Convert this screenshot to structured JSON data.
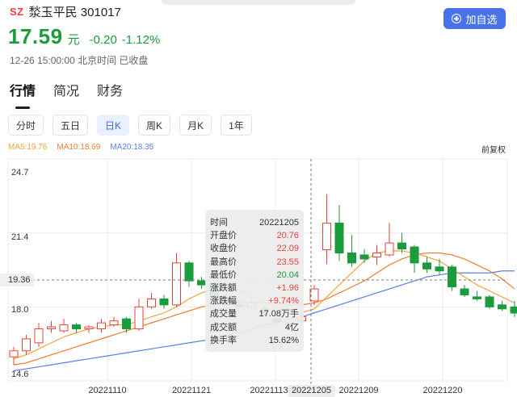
{
  "header": {
    "market": "SZ",
    "name_code": "湬玉平民 301017",
    "price": "17.59",
    "unit": "元",
    "change": "-0.20",
    "change_pct": "-1.12%",
    "status": "12-26 15:00:00 北京时间 已收盘",
    "add_button": "加自选"
  },
  "tabs": [
    "行情",
    "简况",
    "财务"
  ],
  "periods": [
    {
      "label": "分时",
      "active": false
    },
    {
      "label": "五日",
      "active": false
    },
    {
      "label": "日K",
      "active": true
    },
    {
      "label": "周K",
      "active": false
    },
    {
      "label": "月K",
      "active": false
    },
    {
      "label": "1年",
      "active": false
    }
  ],
  "ma": [
    {
      "label": "MA5:19.76",
      "color": "#f2a33a"
    },
    {
      "label": "MA10:18.69",
      "color": "#f07b2e"
    },
    {
      "label": "MA20:18.35",
      "color": "#5b7ee8"
    }
  ],
  "adjust_label": "前复权",
  "tooltip": {
    "rows": [
      {
        "label": "时间",
        "value": "20221205",
        "color": "normal"
      },
      {
        "label": "开盘价",
        "value": "20.76",
        "color": "red"
      },
      {
        "label": "收盘价",
        "value": "22.09",
        "color": "red"
      },
      {
        "label": "最高价",
        "value": "23.55",
        "color": "red"
      },
      {
        "label": "最低价",
        "value": "20.04",
        "color": "green"
      },
      {
        "label": "涨跌额",
        "value": "+1.96",
        "color": "red"
      },
      {
        "label": "涨跌幅",
        "value": "+9.74%",
        "color": "red"
      },
      {
        "label": "成交量",
        "value": "17.08万手",
        "color": "normal"
      },
      {
        "label": "成交额",
        "value": "4亿",
        "color": "normal"
      },
      {
        "label": "换手率",
        "value": "15.62%",
        "color": "normal"
      }
    ]
  },
  "chart_data": {
    "type": "candlestick",
    "colors": {
      "up": "#e8433a",
      "down": "#1a9b3c",
      "ma5": "#f2a33a",
      "ma10": "#f07b2e",
      "ma20": "#5b7ee8"
    },
    "y_ticks": [
      "24.7",
      "21.4",
      "18.0",
      "14.6"
    ],
    "crosshair_price": "19.36",
    "crosshair_date": "20221205",
    "x_ticks": [
      "20221110",
      "20221121",
      "20221113",
      "20221209",
      "20221220"
    ],
    "ylim": [
      14.6,
      24.7
    ],
    "candles": [
      {
        "o": 15.4,
        "c": 15.7,
        "h": 15.9,
        "l": 15.0
      },
      {
        "o": 15.7,
        "c": 16.3,
        "h": 16.5,
        "l": 15.5
      },
      {
        "o": 16.1,
        "c": 16.8,
        "h": 17.1,
        "l": 15.9
      },
      {
        "o": 16.8,
        "c": 16.9,
        "h": 17.2,
        "l": 16.6
      },
      {
        "o": 16.7,
        "c": 17.0,
        "h": 17.3,
        "l": 16.6
      },
      {
        "o": 17.0,
        "c": 16.8,
        "h": 17.1,
        "l": 16.6
      },
      {
        "o": 16.8,
        "c": 16.9,
        "h": 17.0,
        "l": 16.6
      },
      {
        "o": 16.8,
        "c": 17.1,
        "h": 17.3,
        "l": 16.6
      },
      {
        "o": 17.0,
        "c": 17.2,
        "h": 17.4,
        "l": 16.9
      },
      {
        "o": 17.3,
        "c": 16.8,
        "h": 17.4,
        "l": 16.6
      },
      {
        "o": 16.8,
        "c": 17.9,
        "h": 18.3,
        "l": 16.7
      },
      {
        "o": 17.9,
        "c": 18.3,
        "h": 18.6,
        "l": 17.8
      },
      {
        "o": 18.3,
        "c": 18.0,
        "h": 18.5,
        "l": 17.8
      },
      {
        "o": 18.0,
        "c": 20.1,
        "h": 20.6,
        "l": 17.9
      },
      {
        "o": 20.1,
        "c": 19.2,
        "h": 20.2,
        "l": 18.9
      },
      {
        "o": 19.2,
        "c": 19.0,
        "h": 19.4,
        "l": 18.8
      },
      {
        "o": 19.1,
        "c": 18.4,
        "h": 19.2,
        "l": 18.2
      },
      {
        "o": 18.4,
        "c": 18.0,
        "h": 18.6,
        "l": 17.8
      },
      {
        "o": 18.0,
        "c": 17.9,
        "h": 18.3,
        "l": 17.8
      },
      {
        "o": 17.9,
        "c": 18.1,
        "h": 18.4,
        "l": 17.8
      },
      {
        "o": 17.8,
        "c": 17.6,
        "h": 18.0,
        "l": 17.3
      },
      {
        "o": 17.3,
        "c": 17.1,
        "h": 17.5,
        "l": 16.9
      },
      {
        "o": 17.1,
        "c": 17.0,
        "h": 17.3,
        "l": 16.8
      },
      {
        "o": 17.2,
        "c": 17.4,
        "h": 17.6,
        "l": 17.0
      },
      {
        "o": 18.2,
        "c": 18.8,
        "h": 19.0,
        "l": 18.0
      },
      {
        "o": 20.76,
        "c": 22.09,
        "h": 23.55,
        "l": 20.04
      },
      {
        "o": 22.1,
        "c": 20.6,
        "h": 23.0,
        "l": 20.2
      },
      {
        "o": 20.6,
        "c": 20.1,
        "h": 21.5,
        "l": 19.9
      },
      {
        "o": 20.5,
        "c": 20.3,
        "h": 20.8,
        "l": 20.1
      },
      {
        "o": 20.4,
        "c": 20.6,
        "h": 21.0,
        "l": 20.0
      },
      {
        "o": 20.5,
        "c": 21.1,
        "h": 22.1,
        "l": 20.4
      },
      {
        "o": 21.1,
        "c": 20.8,
        "h": 21.6,
        "l": 20.6
      },
      {
        "o": 20.9,
        "c": 20.1,
        "h": 21.0,
        "l": 19.6
      },
      {
        "o": 20.1,
        "c": 19.8,
        "h": 20.4,
        "l": 19.6
      },
      {
        "o": 19.9,
        "c": 19.7,
        "h": 20.3,
        "l": 19.5
      },
      {
        "o": 19.9,
        "c": 18.9,
        "h": 20.0,
        "l": 18.7
      },
      {
        "o": 18.8,
        "c": 18.5,
        "h": 19.0,
        "l": 18.4
      },
      {
        "o": 18.4,
        "c": 18.3,
        "h": 18.7,
        "l": 18.2
      },
      {
        "o": 18.4,
        "c": 17.9,
        "h": 18.5,
        "l": 17.8
      },
      {
        "o": 18.0,
        "c": 17.8,
        "h": 18.2,
        "l": 17.7
      },
      {
        "o": 17.9,
        "c": 17.59,
        "h": 18.2,
        "l": 17.4
      }
    ],
    "ma5": [
      15.3,
      15.5,
      15.8,
      16.1,
      16.4,
      16.6,
      16.8,
      16.9,
      17.0,
      17.0,
      17.2,
      17.4,
      17.6,
      17.9,
      18.3,
      18.6,
      18.8,
      18.8,
      18.7,
      18.5,
      18.1,
      17.9,
      17.7,
      17.6,
      17.8,
      18.4,
      19.0,
      19.6,
      20.2,
      20.6,
      20.7,
      20.7,
      20.6,
      20.4,
      20.2,
      19.8,
      19.4,
      19.0,
      18.7,
      18.4,
      18.1
    ],
    "ma10": [
      15.0,
      15.1,
      15.3,
      15.5,
      15.7,
      15.9,
      16.1,
      16.3,
      16.5,
      16.7,
      16.9,
      17.1,
      17.3,
      17.5,
      17.7,
      17.9,
      18.0,
      18.1,
      18.1,
      18.1,
      18.1,
      18.1,
      18.0,
      18.0,
      18.1,
      18.3,
      18.6,
      18.9,
      19.2,
      19.6,
      20.0,
      20.3,
      20.5,
      20.6,
      20.6,
      20.5,
      20.3,
      20.0,
      19.7,
      19.3,
      18.8
    ],
    "ma20": [
      14.7,
      14.8,
      14.9,
      15.0,
      15.1,
      15.2,
      15.3,
      15.4,
      15.5,
      15.6,
      15.7,
      15.8,
      15.9,
      16.0,
      16.1,
      16.2,
      16.3,
      16.5,
      16.6,
      16.8,
      17.0,
      17.1,
      17.3,
      17.4,
      17.6,
      17.8,
      18.0,
      18.2,
      18.4,
      18.6,
      18.8,
      19.0,
      19.2,
      19.4,
      19.5,
      19.6,
      19.6,
      19.6,
      19.6,
      19.7,
      19.7
    ]
  }
}
